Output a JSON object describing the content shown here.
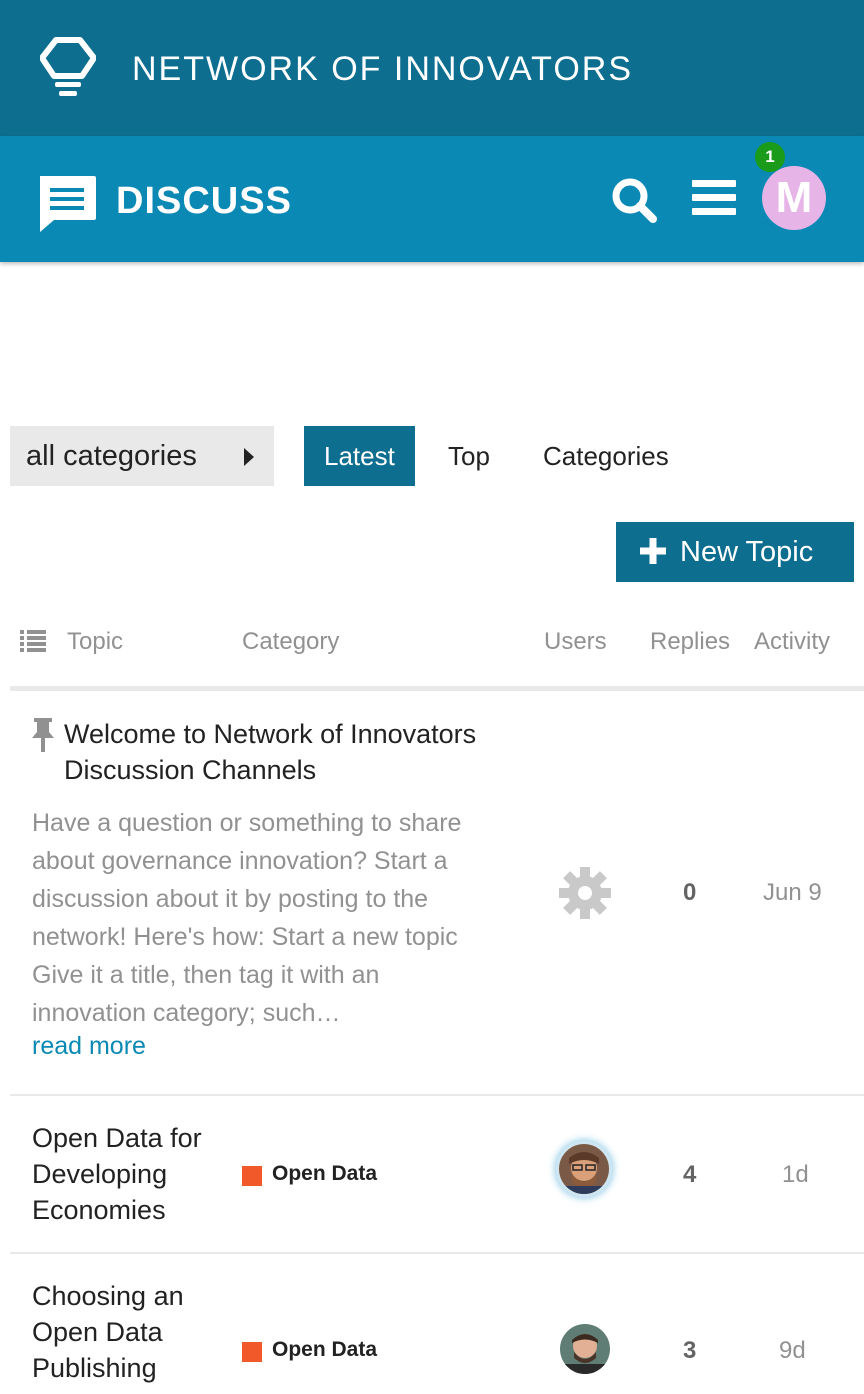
{
  "site": {
    "title": "NETWORK OF INNOVATORS",
    "logo_icon": "lightbulb-icon"
  },
  "header": {
    "title": "DISCUSS",
    "chat_icon": "chat-bubble-icon",
    "search_icon": "search-icon",
    "menu_icon": "hamburger-menu-icon",
    "avatar_letter": "M",
    "notifications": "1"
  },
  "nav": {
    "category_dropdown": "all categories",
    "tabs": [
      {
        "label": "Latest",
        "active": true
      },
      {
        "label": "Top",
        "active": false
      },
      {
        "label": "Categories",
        "active": false
      }
    ]
  },
  "new_topic_label": "New Topic",
  "columns": {
    "topic": "Topic",
    "category": "Category",
    "users": "Users",
    "replies": "Replies",
    "activity": "Activity"
  },
  "topics": [
    {
      "pinned": true,
      "title_line1": "Welcome to Network of Innovators",
      "title_line2": "Discussion Channels",
      "excerpt": "Have a question or something to share about governance innovation? Start a discussion about it by posting to the network! Here's how: Start a new topic Give it a title, then tag it with an innovation category; such…",
      "read_more": "read more",
      "users_icon": "gear-icon",
      "replies": "0",
      "activity": "Jun 9"
    },
    {
      "title_line1": "Open Data for",
      "title_line2": "Developing",
      "title_line3": "Economies",
      "category": "Open Data",
      "category_color": "#f1592a",
      "replies": "4",
      "activity": "1d"
    },
    {
      "title_line1": "Choosing an",
      "title_line2": "Open Data",
      "title_line3": "Publishing",
      "category": "Open Data",
      "category_color": "#f1592a",
      "replies": "3",
      "activity": "9d"
    }
  ],
  "colors": {
    "brand_dark": "#0e6e8f",
    "brand": "#0b89b5",
    "badge_green": "#1a9b1a",
    "avatar_bg": "#e7b4e7"
  }
}
